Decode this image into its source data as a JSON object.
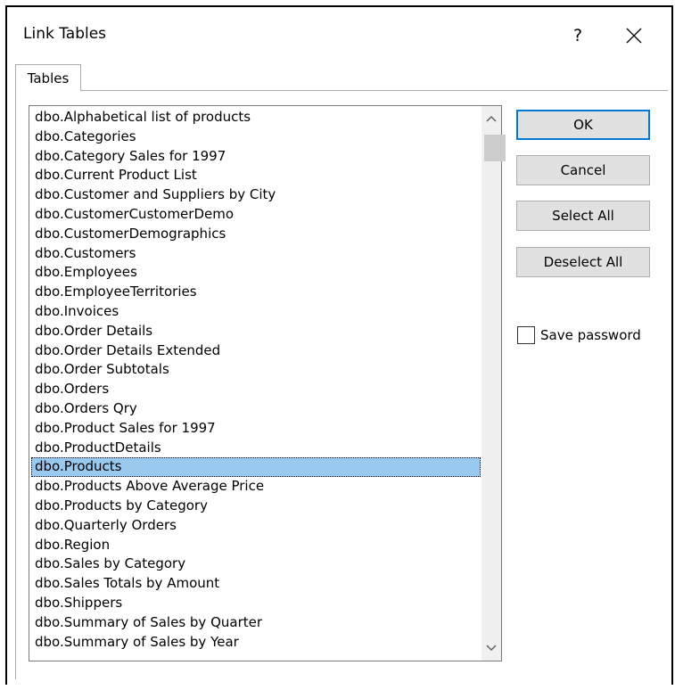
{
  "dialog": {
    "title": "Link Tables",
    "help_label": "?"
  },
  "tabs": [
    {
      "label": "Tables"
    }
  ],
  "list": {
    "items": [
      "dbo.Alphabetical list of products",
      "dbo.Categories",
      "dbo.Category Sales for 1997",
      "dbo.Current Product List",
      "dbo.Customer and Suppliers by City",
      "dbo.CustomerCustomerDemo",
      "dbo.CustomerDemographics",
      "dbo.Customers",
      "dbo.Employees",
      "dbo.EmployeeTerritories",
      "dbo.Invoices",
      "dbo.Order Details",
      "dbo.Order Details Extended",
      "dbo.Order Subtotals",
      "dbo.Orders",
      "dbo.Orders Qry",
      "dbo.Product Sales for 1997",
      "dbo.ProductDetails",
      "dbo.Products",
      "dbo.Products Above Average Price",
      "dbo.Products by Category",
      "dbo.Quarterly Orders",
      "dbo.Region",
      "dbo.Sales by Category",
      "dbo.Sales Totals by Amount",
      "dbo.Shippers",
      "dbo.Summary of Sales by Quarter",
      "dbo.Summary of Sales by Year"
    ],
    "selected": "dbo.Products"
  },
  "buttons": {
    "ok": "OK",
    "cancel": "Cancel",
    "select_all": "Select All",
    "deselect_all": "Deselect All"
  },
  "save_password": {
    "label": "Save password",
    "checked": false
  },
  "colors": {
    "selection": "#99c9ef",
    "default_button_border": "#0078d7",
    "button_face": "#e1e1e1"
  }
}
